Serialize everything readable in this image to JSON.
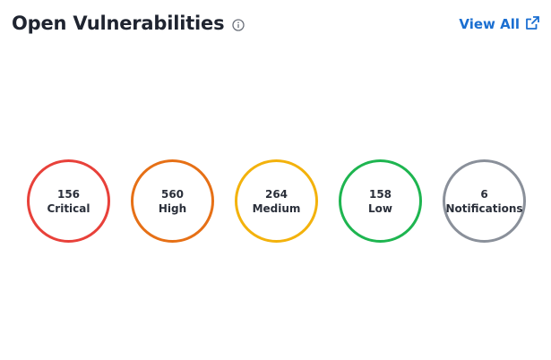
{
  "header": {
    "title": "Open Vulnerabilities",
    "info_icon": "info-circle-icon",
    "view_all_label": "View All",
    "view_all_icon": "external-link-icon",
    "link_color": "#1b6fd1"
  },
  "severities": [
    {
      "count": "156",
      "label": "Critical",
      "color": "#e8413a"
    },
    {
      "count": "560",
      "label": "High",
      "color": "#e67016"
    },
    {
      "count": "264",
      "label": "Medium",
      "color": "#f3b20c"
    },
    {
      "count": "158",
      "label": "Low",
      "color": "#1eb550"
    },
    {
      "count": "6",
      "label": "Notifications",
      "color": "#8a909a"
    }
  ]
}
